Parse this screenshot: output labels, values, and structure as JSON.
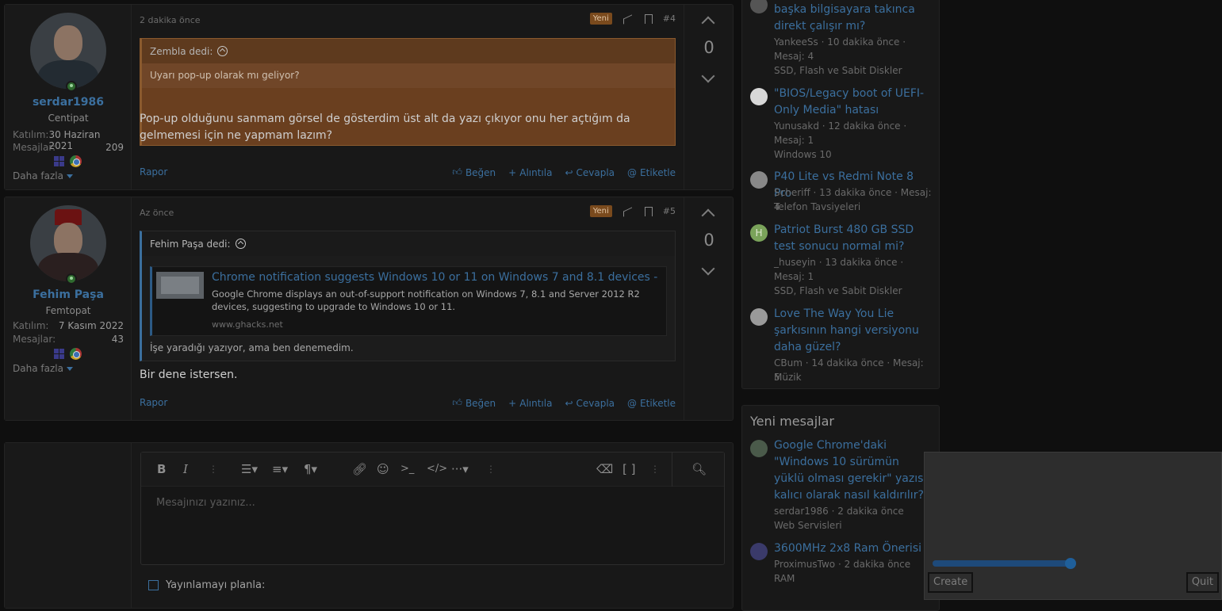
{
  "posts": [
    {
      "username": "serdar1986",
      "user_title": "Centipat",
      "joined_label": "Katılım:",
      "joined_value": "30 Haziran 2021",
      "messages_label": "Mesajlar:",
      "messages_value": "209",
      "more_label": "Daha fazla",
      "time": "2 dakika önce",
      "badge": "Yeni",
      "post_number": "#4",
      "score": "0",
      "quote_author": "Zembla dedi:",
      "quote_text": "Uyarı pop-up olarak mı geliyor?",
      "body": "Pop-up olduğunu sanmam görsel de gösterdim üst alt da yazı çıkıyor onu her açtığım da gelmemesi için ne yapmam lazım?",
      "report": "Rapor",
      "like": "Beğen",
      "quote_action": "Alıntıla",
      "reply": "Cevapla",
      "tag": "Etiketle"
    },
    {
      "username": "Fehim Paşa",
      "user_title": "Femtopat",
      "joined_label": "Katılım:",
      "joined_value": "7 Kasım 2022",
      "messages_label": "Mesajlar:",
      "messages_value": "43",
      "more_label": "Daha fazla",
      "time": "Az önce",
      "badge": "Yeni",
      "post_number": "#5",
      "score": "0",
      "quote_author": "Fehim Paşa dedi:",
      "link_title": "Chrome notification suggests Windows 10 or 11 on Windows 7 and 8.1 devices - g...",
      "link_desc": "Google Chrome displays an out-of-support notification on Windows 7, 8.1 and Server 2012 R2 devices, suggesting to upgrade to Windows 10 or 11.",
      "link_domain": "www.ghacks.net",
      "quote_text": "İşe yaradığı yazıyor, ama ben denemedim.",
      "body": "Bir dene istersen.",
      "report": "Rapor",
      "like": "Beğen",
      "quote_action": "Alıntıla",
      "reply": "Cevapla",
      "tag": "Etiketle"
    }
  ],
  "editor": {
    "placeholder": "Mesajınızı yazınız...",
    "schedule_label": "Yayınlamayı planla:"
  },
  "sidebar_top": [
    {
      "title": "başka bilgisayara takınca direkt çalışır mı?",
      "meta": "YankeeSs · 10 dakika önce · Mesaj: 4",
      "forum": "SSD, Flash ve Sabit Diskler"
    },
    {
      "title": "\"BIOS/Legacy boot of UEFI-Only Media\" hatası",
      "meta": "Yunusakd · 12 dakika önce · Mesaj: 1",
      "forum": "Windows 10"
    },
    {
      "title": "P40 Lite vs Redmi Note 8 Pro",
      "meta": "Scheriff · 13 dakika önce · Mesaj: 4",
      "forum": "Telefon Tavsiyeleri"
    },
    {
      "title": "Patriot Burst 480 GB SSD test sonucu normal mi?",
      "meta": "_huseyin · 13 dakika önce · Mesaj: 1",
      "forum": "SSD, Flash ve Sabit Diskler",
      "avatar_letter": "H"
    },
    {
      "title": "Love The Way You Lie şarkısının hangi versiyonu daha güzel?",
      "meta": "CBum · 14 dakika önce · Mesaj: 5",
      "forum": "Müzik"
    }
  ],
  "sidebar_new": {
    "heading": "Yeni mesajlar",
    "items": [
      {
        "title": "Google Chrome'daki \"Windows 10 sürümün yüklü olması gerekir\" yazısı kalıcı olarak nasıl kaldırılır?",
        "meta": "serdar1986 · 2 dakika önce",
        "forum": "Web Servisleri"
      },
      {
        "title": "3600MHz 2x8 Ram Önerisi",
        "meta": "ProximusTwo · 2 dakika önce",
        "forum": "RAM"
      }
    ]
  },
  "overlay": {
    "create_label": "Create",
    "quit_label": "Quit",
    "slider_value": 1.0
  }
}
